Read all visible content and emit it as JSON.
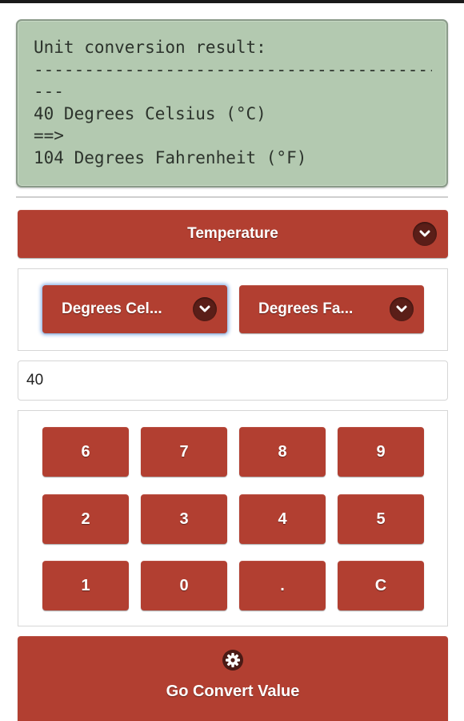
{
  "result_display": {
    "lines": [
      "Unit conversion result:",
      "--------------------------------------------",
      "---",
      "40 Degrees Celsius (°C)",
      "==>",
      "104 Degrees Fahrenheit (°F)"
    ]
  },
  "category": {
    "label": "Temperature"
  },
  "units": {
    "from_label": "Degrees Cel...",
    "to_label": "Degrees Fa..."
  },
  "input": {
    "value": "40"
  },
  "keypad": {
    "keys": [
      "6",
      "7",
      "8",
      "9",
      "2",
      "3",
      "4",
      "5",
      "1",
      "0",
      ".",
      "C"
    ]
  },
  "convert_button": {
    "label": "Go Convert Value",
    "icon": "gear-icon"
  },
  "colors": {
    "accent_red": "#b23f31",
    "lcd_green": "#b3c9b0",
    "chevron_dark": "#5a1e18"
  }
}
